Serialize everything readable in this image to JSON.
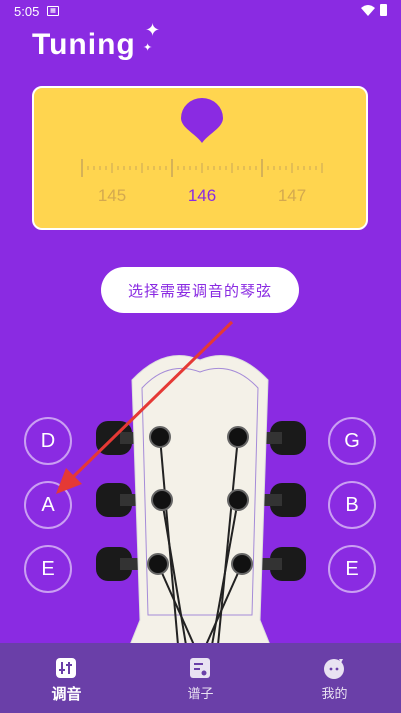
{
  "status_bar": {
    "time": "5:05",
    "sim_icon": "sim-icon",
    "wifi_icon": "wifi-icon",
    "battery_icon": "battery-icon"
  },
  "app": {
    "title": "Tuning",
    "sparkle": "✦"
  },
  "tuner": {
    "indicator_icon": "pitch-pin-icon",
    "frequencies": {
      "low": "145",
      "current": "146",
      "high": "147"
    },
    "colors": {
      "panel": "#ffd54f",
      "accent": "#8a2be2",
      "muted": "#d4a94f"
    }
  },
  "select_string": {
    "label": "选择需要调音的琴弦"
  },
  "strings": {
    "left": [
      "D",
      "A",
      "E"
    ],
    "right": [
      "G",
      "B",
      "E"
    ]
  },
  "annotation": {
    "type": "red-arrow",
    "color": "#e53935"
  },
  "bottom_nav": {
    "items": [
      {
        "label": "调音",
        "icon": "tuner-icon",
        "active": true
      },
      {
        "label": "谱子",
        "icon": "sheet-music-icon",
        "active": false
      },
      {
        "label": "我的",
        "icon": "profile-icon",
        "active": false
      }
    ]
  },
  "theme": {
    "background": "#8a2be2",
    "nav_bg": "#6a3fa8"
  }
}
